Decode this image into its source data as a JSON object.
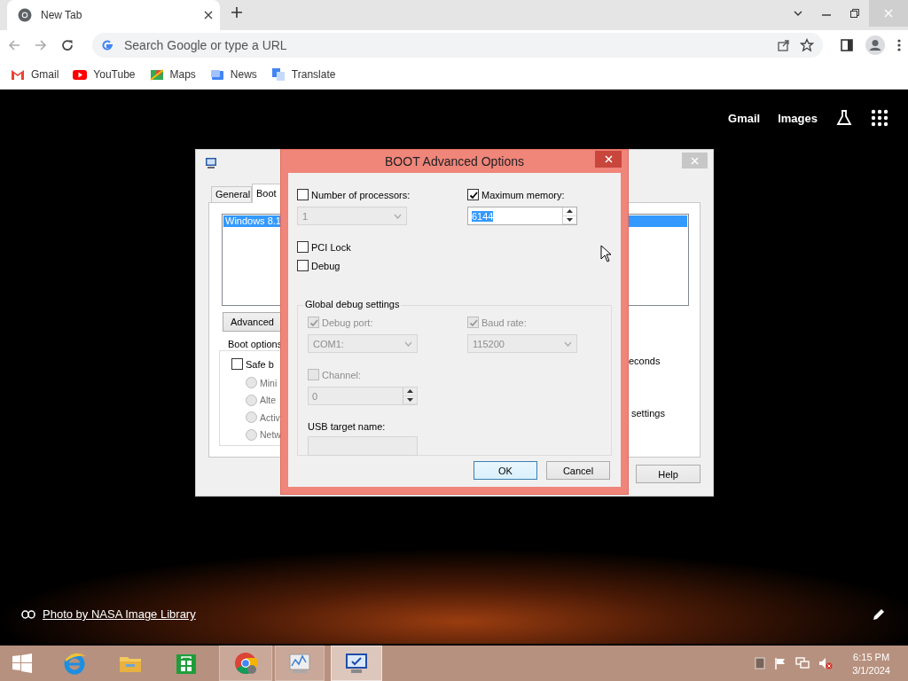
{
  "browser": {
    "tabs": [
      {
        "title": "New Tab",
        "selected": true
      }
    ],
    "address_bar": {
      "placeholder": "Search Google or type a URL"
    },
    "bookmarks": [
      {
        "label": "Gmail",
        "kind": "gmail"
      },
      {
        "label": "YouTube",
        "kind": "youtube"
      },
      {
        "label": "Maps",
        "kind": "maps"
      },
      {
        "label": "News",
        "kind": "news"
      },
      {
        "label": "Translate",
        "kind": "translate"
      }
    ]
  },
  "new_tab_page": {
    "links": [
      "Gmail",
      "Images"
    ],
    "photo_credit": "Photo by NASA Image Library"
  },
  "system_configuration": {
    "tabs": [
      {
        "label": "General",
        "selected": false
      },
      {
        "label": "Boot",
        "selected": true
      }
    ],
    "boot_entries": [
      {
        "label": "Windows 8.1",
        "selected": true
      }
    ],
    "advanced_button": "Advanced",
    "boot_options_title": "Boot options",
    "safe_boot": {
      "label": "Safe b",
      "checked": false
    },
    "safe_boot_modes": [
      {
        "label": "Mini",
        "selected": false
      },
      {
        "label": "Alte",
        "selected": false
      },
      {
        "label": "Activ",
        "selected": false
      },
      {
        "label": "Netw",
        "selected": false
      }
    ],
    "timeout_text": "econds",
    "settings_text": "settings",
    "help_button": "Help"
  },
  "dialog": {
    "title": "BOOT Advanced Options",
    "options": [
      {
        "kind": "dropdown",
        "label": "Number of processors:",
        "checked": false,
        "value": "1"
      },
      {
        "kind": "spinner",
        "label": "Maximum memory:",
        "checked": true,
        "value": "6144"
      }
    ],
    "flags": [
      {
        "label": "PCI Lock",
        "checked": false
      },
      {
        "label": "Debug",
        "checked": false
      }
    ],
    "global_debug_settings": {
      "title": "Global debug settings",
      "settings": [
        {
          "kind": "dropdown",
          "label": "Debug port:",
          "checked": true,
          "disabled": true,
          "value": "COM1:"
        },
        {
          "kind": "dropdown",
          "label": "Baud rate:",
          "checked": true,
          "disabled": true,
          "value": "115200"
        },
        {
          "kind": "spinner",
          "label": "Channel:",
          "checked": false,
          "disabled": true,
          "value": "0"
        }
      ],
      "usb_target_name": {
        "label": "USB target name:",
        "disabled": true
      }
    },
    "buttons": [
      {
        "label": "OK",
        "kind": "default"
      },
      {
        "label": "Cancel",
        "kind": "normal"
      }
    ]
  },
  "taskbar": {
    "apps": [
      {
        "kind": "ie",
        "running": false,
        "selected": false
      },
      {
        "kind": "explorer",
        "running": false,
        "selected": false
      },
      {
        "kind": "store",
        "running": false,
        "selected": false
      },
      {
        "kind": "chrome",
        "running": true,
        "selected": false
      },
      {
        "kind": "monitor",
        "running": true,
        "selected": false
      },
      {
        "kind": "msconfig",
        "running": true,
        "selected": true
      }
    ],
    "clock": {
      "time": "6:15 PM",
      "date": "3/1/2024"
    }
  }
}
